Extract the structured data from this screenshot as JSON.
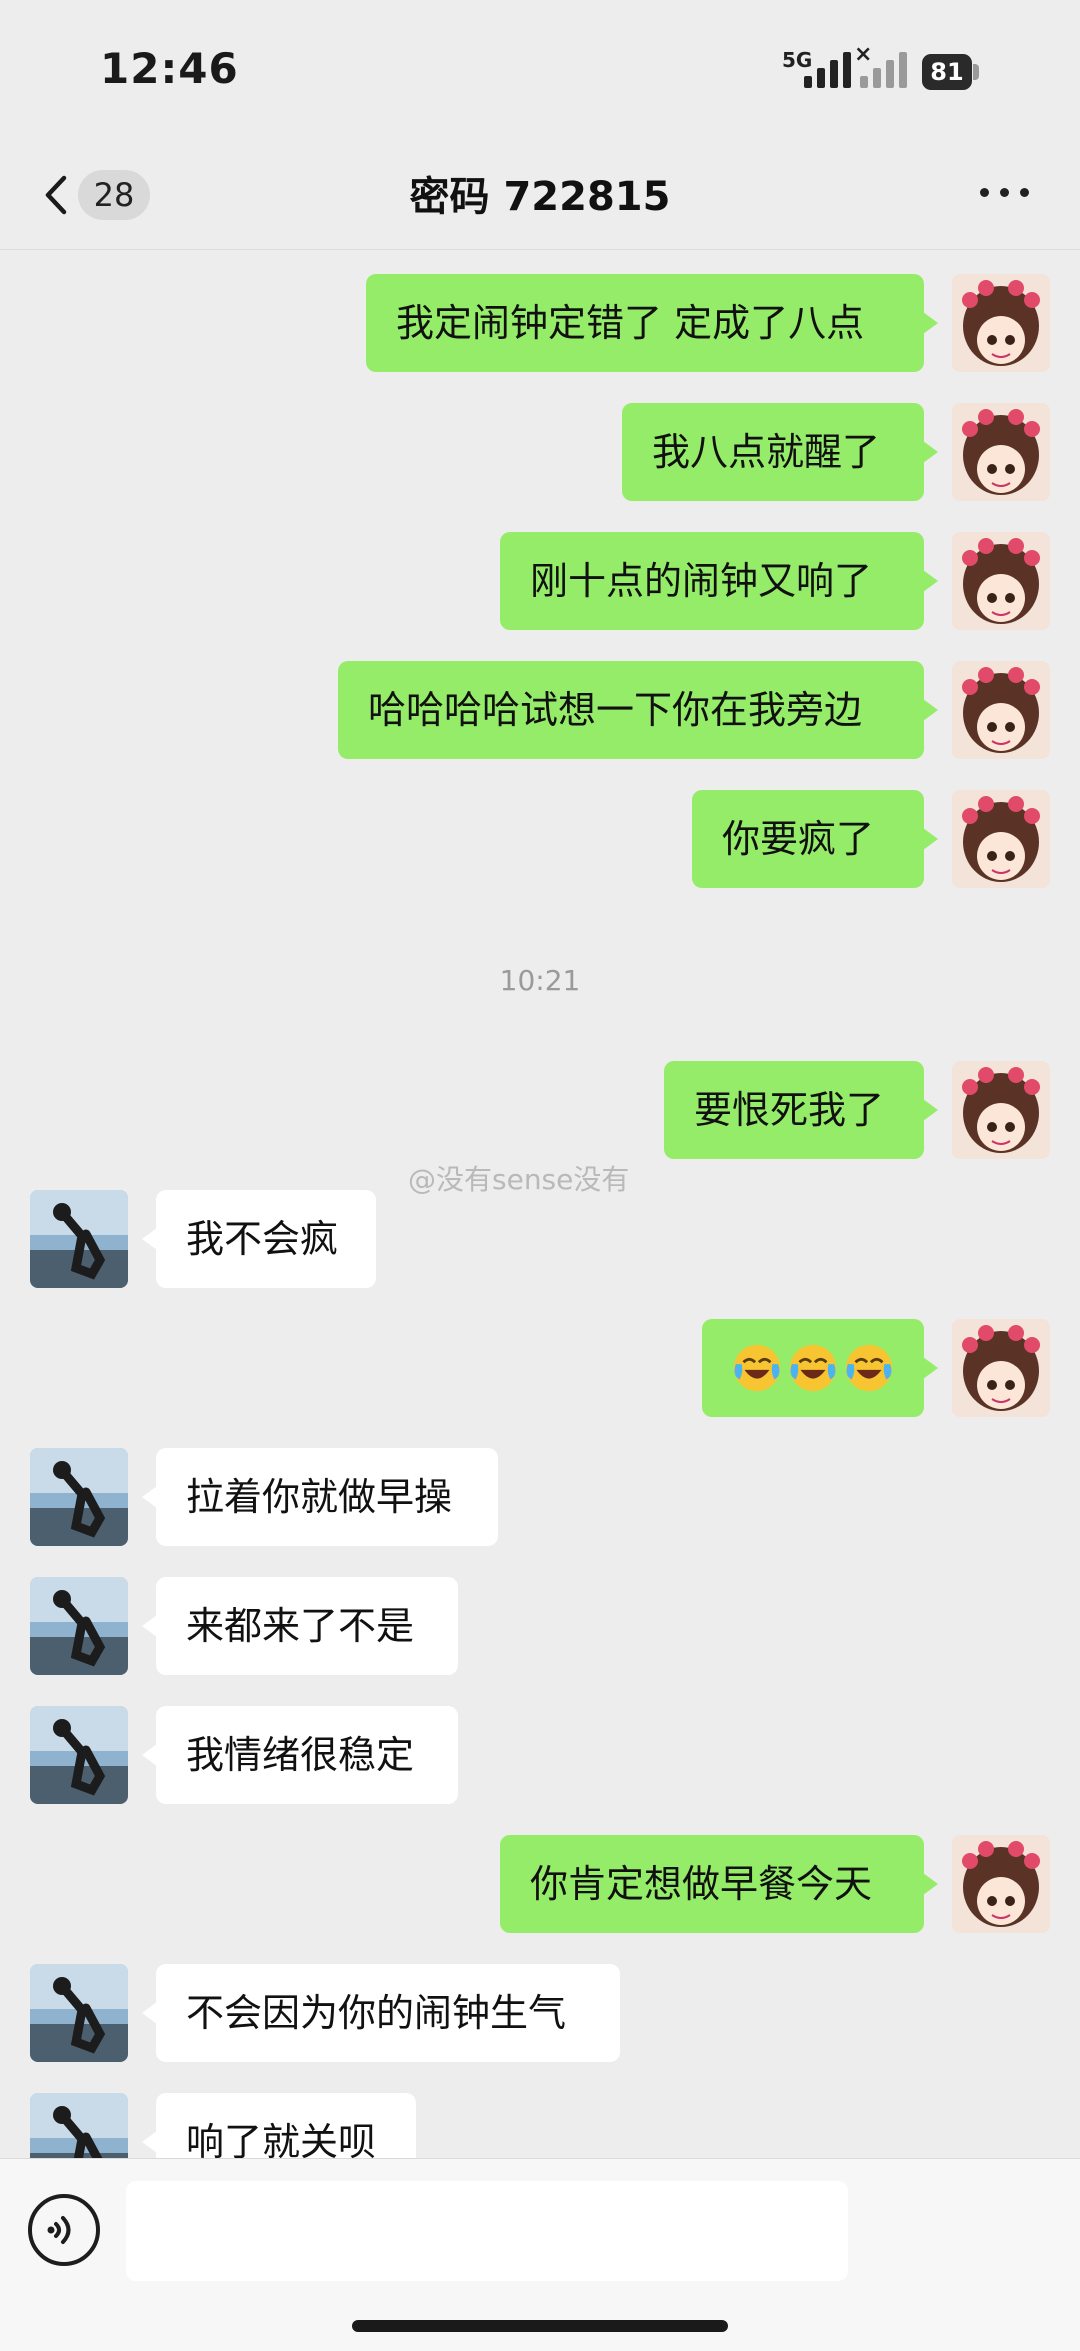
{
  "status_bar": {
    "time": "12:46",
    "network_label": "5G",
    "sim2_label": "×",
    "battery": "81"
  },
  "nav": {
    "unread_count": "28",
    "title": "密码 722815"
  },
  "colors": {
    "my_bubble": "#95ec69",
    "their_bubble": "#ffffff",
    "background": "#ededed"
  },
  "messages": [
    {
      "from": "me",
      "text": "我定闹钟定错了 定成了八点"
    },
    {
      "from": "me",
      "text": "我八点就醒了"
    },
    {
      "from": "me",
      "text": "刚十点的闹钟又响了"
    },
    {
      "from": "me",
      "text": "哈哈哈哈试想一下你在我旁边"
    },
    {
      "from": "me",
      "text": "你要疯了"
    },
    {
      "from": "me",
      "text": "要恨死我了"
    },
    {
      "from": "them",
      "text": "我不会疯"
    },
    {
      "from": "me",
      "text": "",
      "emoji": [
        "loudly-crying-laughing-emoji",
        "loudly-crying-laughing-emoji",
        "loudly-crying-laughing-emoji"
      ]
    },
    {
      "from": "them",
      "text": "拉着你就做早操"
    },
    {
      "from": "them",
      "text": "来都来了不是"
    },
    {
      "from": "them",
      "text": "我情绪很稳定"
    },
    {
      "from": "me",
      "text": "你肯定想做早餐今天"
    },
    {
      "from": "them",
      "text": "不会因为你的闹钟生气"
    },
    {
      "from": "them",
      "text": "响了就关呗"
    }
  ],
  "timestamp": "10:21",
  "watermark": "@没有sense没有",
  "input_bar": {
    "voice_icon": "voice-icon",
    "placeholder": ""
  }
}
